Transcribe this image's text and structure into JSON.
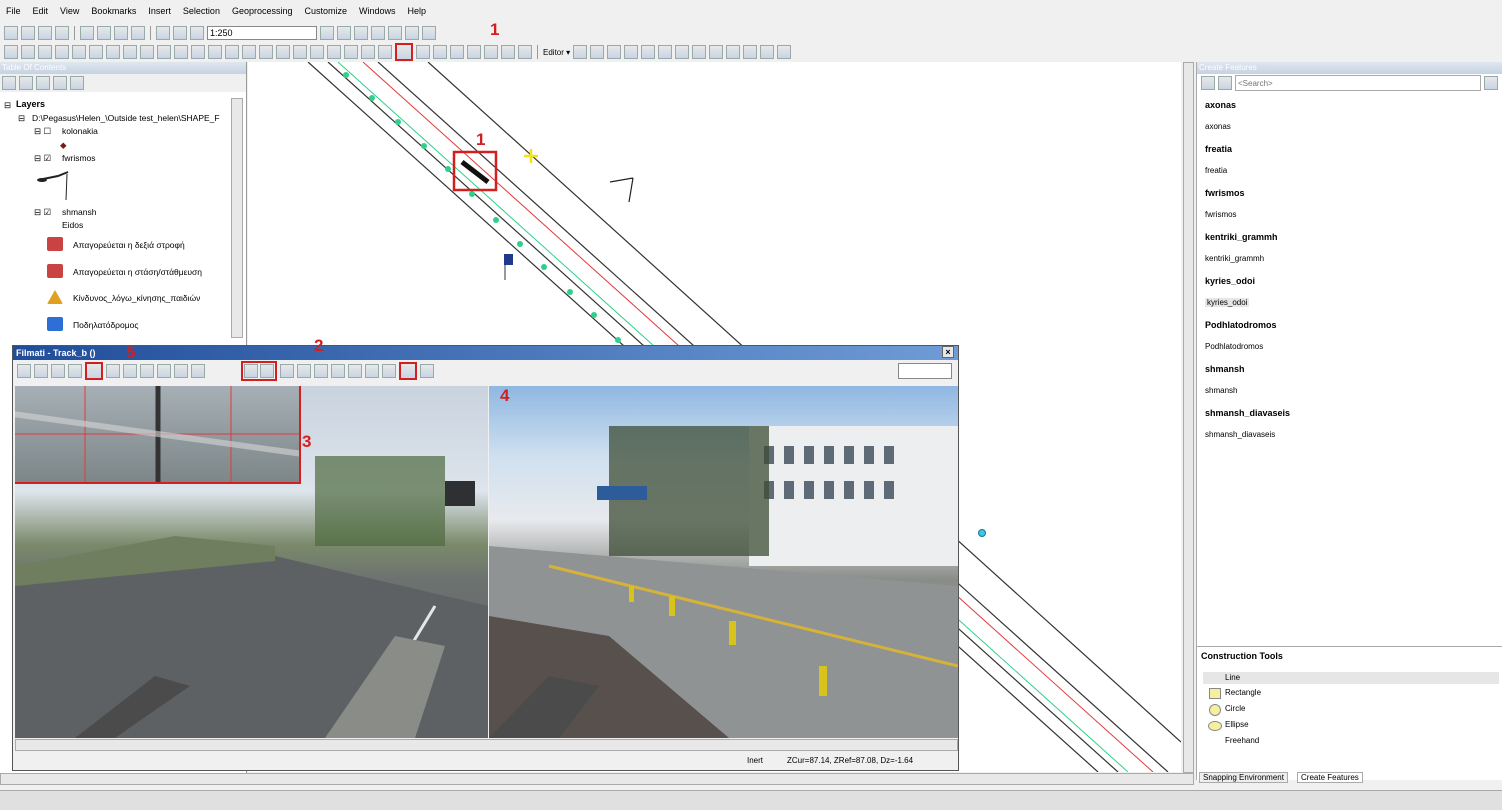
{
  "menu": [
    "File",
    "Edit",
    "View",
    "Bookmarks",
    "Insert",
    "Selection",
    "Geoprocessing",
    "Customize",
    "Windows",
    "Help"
  ],
  "toolbar": {
    "scale": "1:250",
    "editor_label": "Editor ▾"
  },
  "annotations": {
    "n1": "1",
    "n2": "2",
    "n3": "3",
    "n4": "4",
    "n5": "5"
  },
  "toc": {
    "title": "Table Of Contents",
    "layers_label": "Layers",
    "path": "D:\\Pegasus\\Helen_\\Outside test_helen\\SHAPE_F",
    "layer_kolonakia": "kolonakia",
    "layer_fwrismos": "fwrismos",
    "layer_shmansh": "shmansh",
    "field_eidos": "Eidos",
    "legend": [
      "Απαγορεύεται η δεξιά στροφή",
      "Απαγορεύεται η στάση/στάθμευση",
      "Κίνδυνος_λόγω_κίνησης_παιδιών",
      "Ποδηλατόδρομος"
    ]
  },
  "create_features": {
    "title": "Create Features",
    "search_placeholder": "<Search>",
    "groups": [
      {
        "header": "axonas",
        "item": "axonas"
      },
      {
        "header": "freatia",
        "item": "freatia"
      },
      {
        "header": "fwrismos",
        "item": "fwrismos"
      },
      {
        "header": "kentriki_grammh",
        "item": "kentriki_grammh"
      },
      {
        "header": "kyries_odoi",
        "item": "kyries_odoi"
      },
      {
        "header": "Podhlatodromos",
        "item": "Podhlatodromos"
      },
      {
        "header": "shmansh",
        "item": "shmansh"
      },
      {
        "header": "shmansh_diavaseis",
        "item": "shmansh_diavaseis"
      }
    ],
    "construction_title": "Construction Tools",
    "tools": [
      "Line",
      "Rectangle",
      "Circle",
      "Ellipse",
      "Freehand"
    ],
    "tab_snapping": "Snapping Environment",
    "tab_create": "Create Features"
  },
  "filmati": {
    "title": "Filmati - Track_b ()",
    "close": "×",
    "status_mode": "Inert",
    "status_z": "ZCur=87.14, ZRef=87.08, Dz=-1.64"
  },
  "colors": {
    "annotation_red": "#d21f1f",
    "title_blue": "#1f4d9a"
  }
}
